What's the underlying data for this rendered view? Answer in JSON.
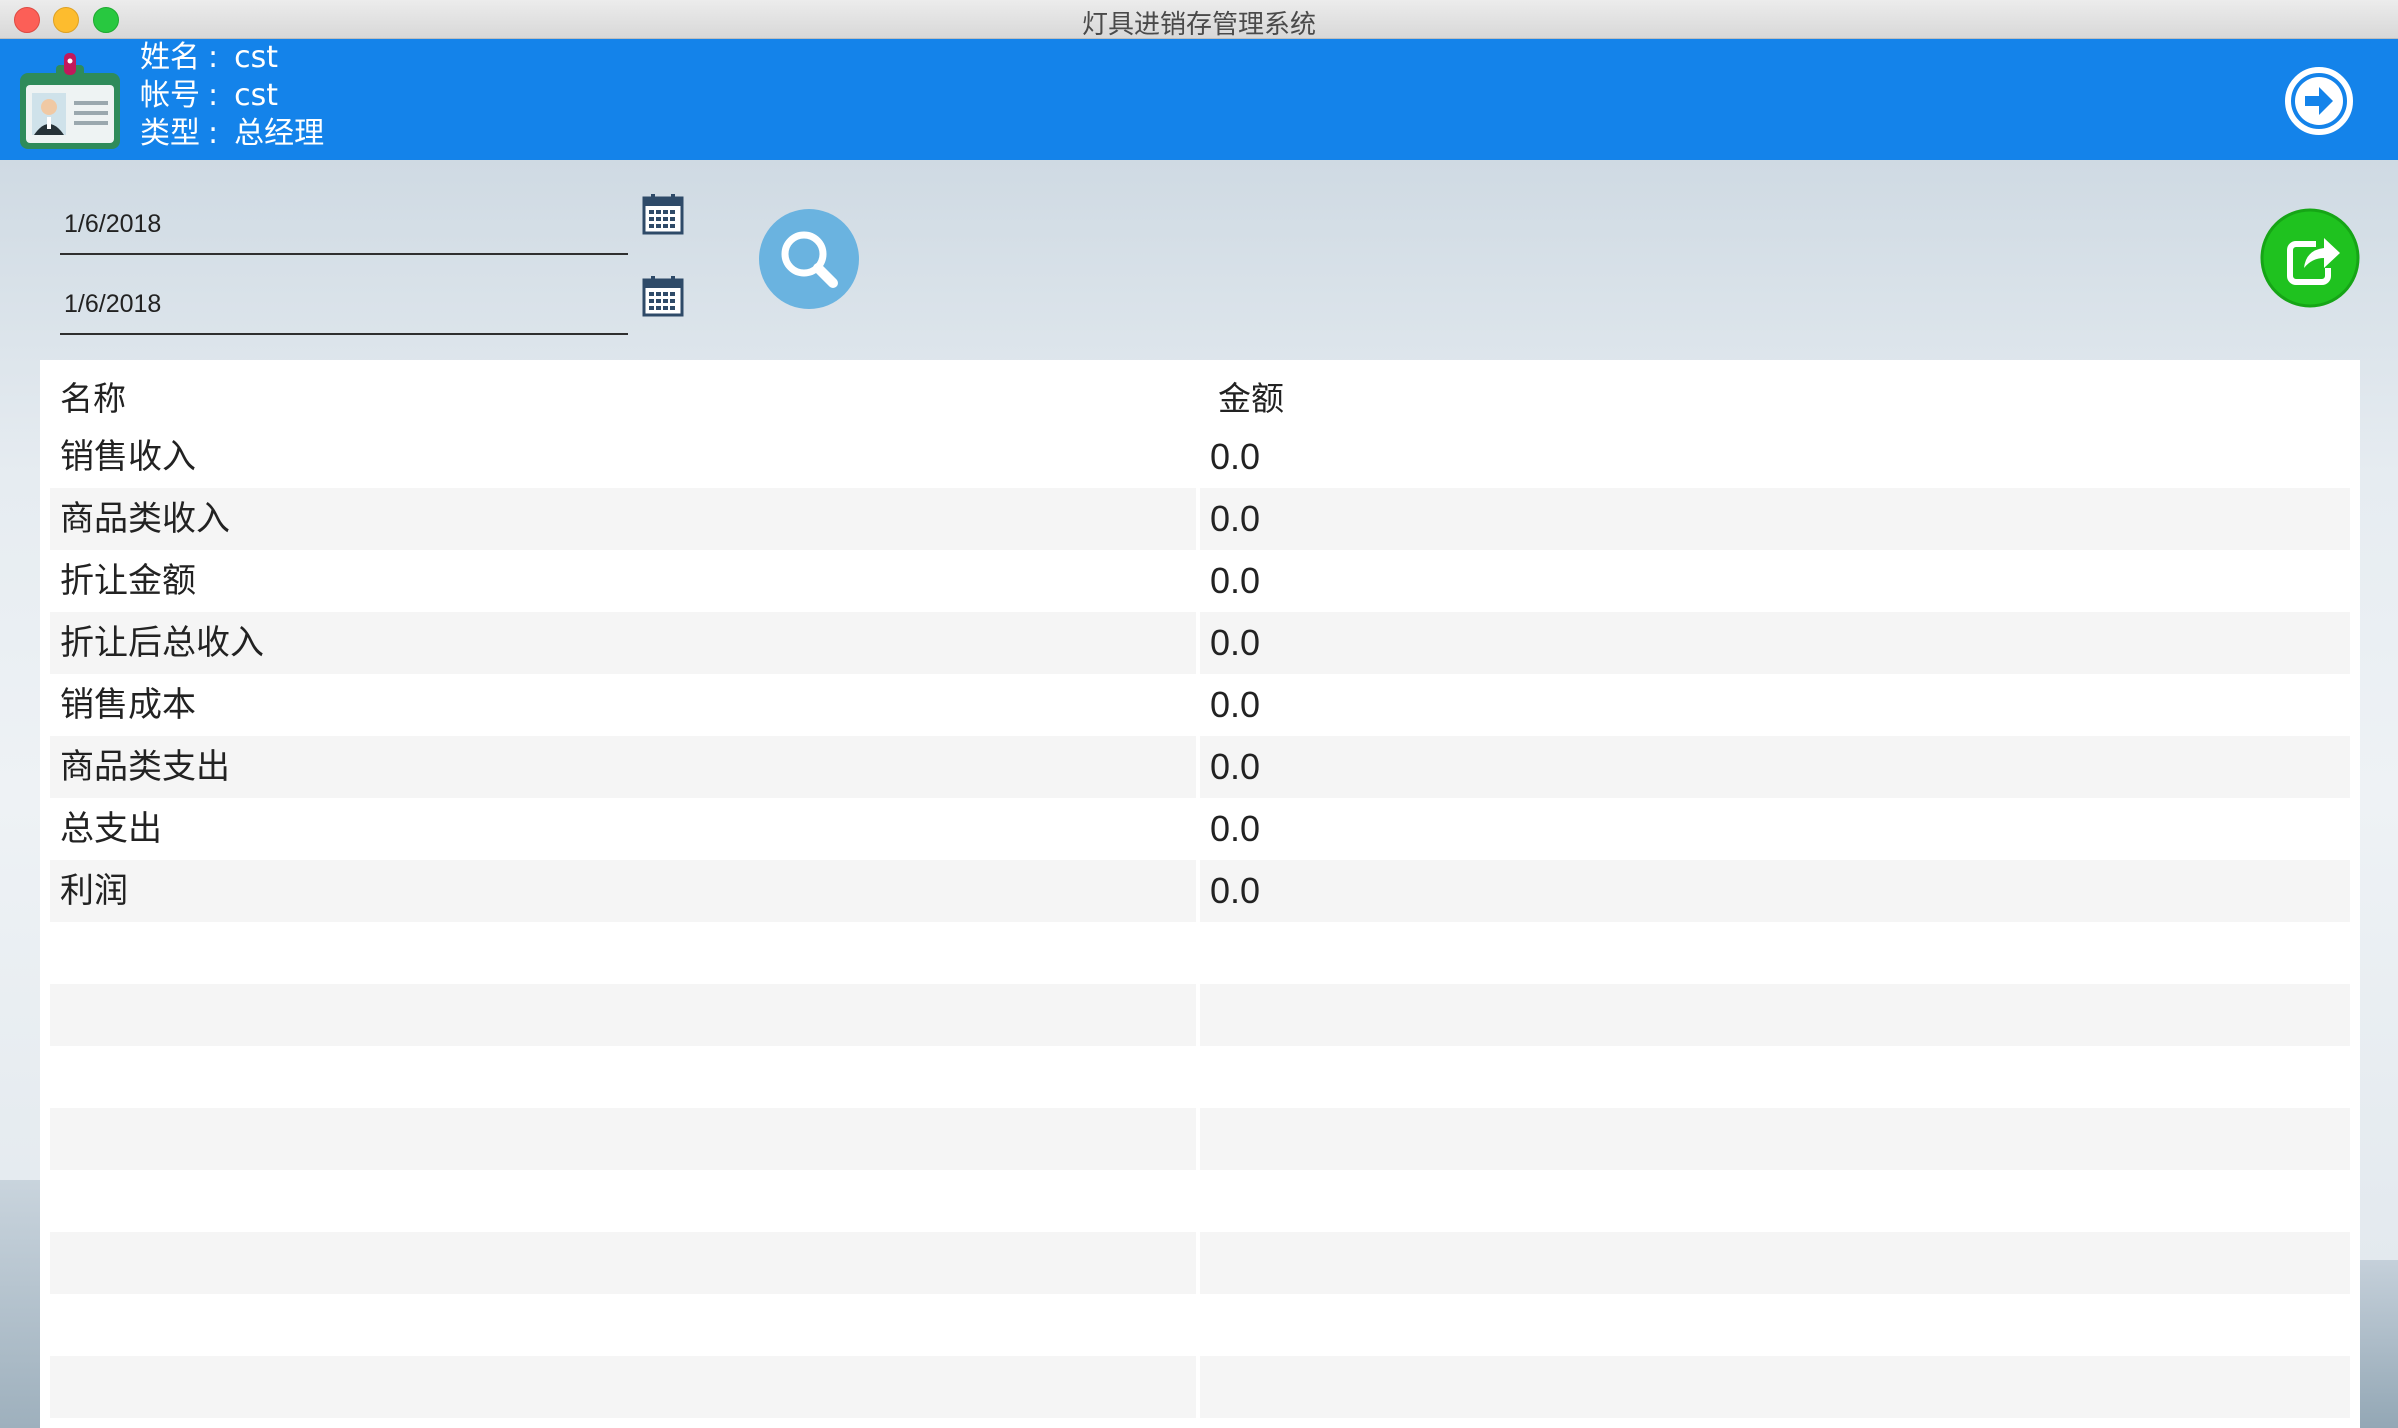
{
  "window": {
    "title": "灯具进销存管理系统"
  },
  "user": {
    "name_label": "姓名",
    "name": "cst",
    "account_label": "帐号",
    "account": "cst",
    "type_label": "类型",
    "type": "总经理",
    "separator": ":"
  },
  "filters": {
    "start_date": "1/6/2018",
    "end_date": "1/6/2018"
  },
  "table": {
    "columns": [
      "名称",
      "金额"
    ],
    "rows": [
      {
        "name": "销售收入",
        "amount": "0.0"
      },
      {
        "name": "商品类收入",
        "amount": "0.0"
      },
      {
        "name": "折让金额",
        "amount": "0.0"
      },
      {
        "name": "折让后总收入",
        "amount": "0.0"
      },
      {
        "name": "销售成本",
        "amount": "0.0"
      },
      {
        "name": "商品类支出",
        "amount": "0.0"
      },
      {
        "name": "总支出",
        "amount": "0.0"
      },
      {
        "name": "利润",
        "amount": "0.0"
      }
    ]
  },
  "colors": {
    "header_blue": "#1483ea",
    "search_button": "#6ab3e0",
    "export_button": "#1fc21f"
  },
  "icons": {
    "badge": "id-badge-icon",
    "logout": "arrow-right-circle-icon",
    "calendar": "calendar-icon",
    "search": "search-icon",
    "export": "share-export-icon"
  }
}
